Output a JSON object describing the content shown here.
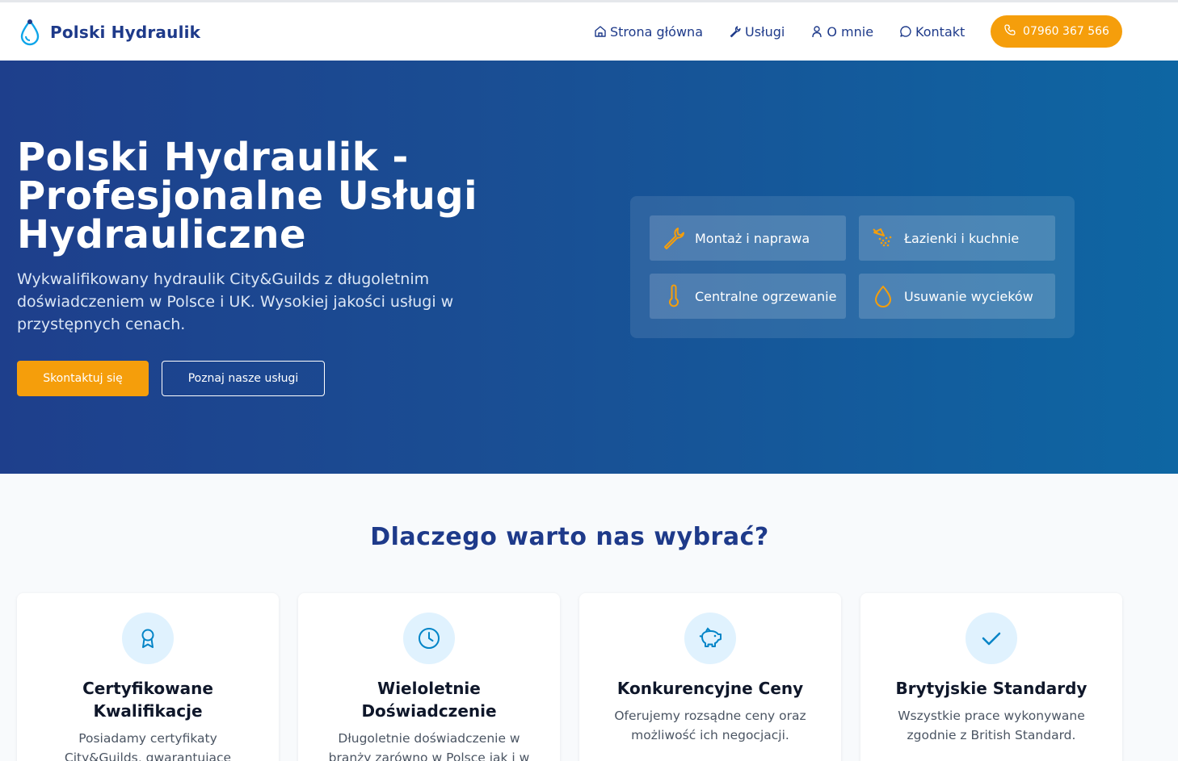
{
  "brand": {
    "name": "Polski Hydraulik",
    "logo_icon": "water-drop-icon"
  },
  "nav": {
    "items": [
      {
        "label": "Strona główna",
        "icon": "home-icon"
      },
      {
        "label": "Usługi",
        "icon": "wrench-icon"
      },
      {
        "label": "O mnie",
        "icon": "user-icon"
      },
      {
        "label": "Kontakt",
        "icon": "chat-icon"
      }
    ],
    "phone": {
      "label": "07960 367 566",
      "icon": "phone-icon"
    }
  },
  "hero": {
    "title": "Polski Hydraulik - Profesjonalne Usługi Hydrauliczne",
    "lead": "Wykwalifikowany hydraulik City&Guilds z długoletnim doświadczeniem w Polsce i UK. Wysokiej jakości usługi w przystępnych cenach.",
    "cta_primary": "Skontaktuj się",
    "cta_secondary": "Poznaj nasze usługi",
    "services": [
      {
        "label": "Montaż i naprawa",
        "icon": "wrench-icon"
      },
      {
        "label": "Łazienki i kuchnie",
        "icon": "shower-icon"
      },
      {
        "label": "Centralne ogrzewanie",
        "icon": "thermometer-icon"
      },
      {
        "label": "Usuwanie wycieków",
        "icon": "droplet-icon"
      }
    ]
  },
  "why": {
    "title": "Dlaczego warto nas wybrać?",
    "cards": [
      {
        "title": "Certyfikowane Kwalifikacje",
        "text": "Posiadamy certyfikaty City&Guilds, gwarantujące",
        "icon": "award-icon"
      },
      {
        "title": "Wieloletnie Doświadczenie",
        "text": "Długoletnie doświadczenie w branży zarówno w Polsce jak i w",
        "icon": "clock-icon"
      },
      {
        "title": "Konkurencyjne Ceny",
        "text": "Oferujemy rozsądne ceny oraz możliwość ich negocjacji.",
        "icon": "piggy-bank-icon"
      },
      {
        "title": "Brytyjskie Standardy",
        "text": "Wszystkie prace wykonywane zgodnie z British Standard.",
        "icon": "check-icon"
      }
    ]
  },
  "colors": {
    "accent": "#f59e0b",
    "brand": "#1e3a8a",
    "icon_blue": "#0284c7"
  }
}
